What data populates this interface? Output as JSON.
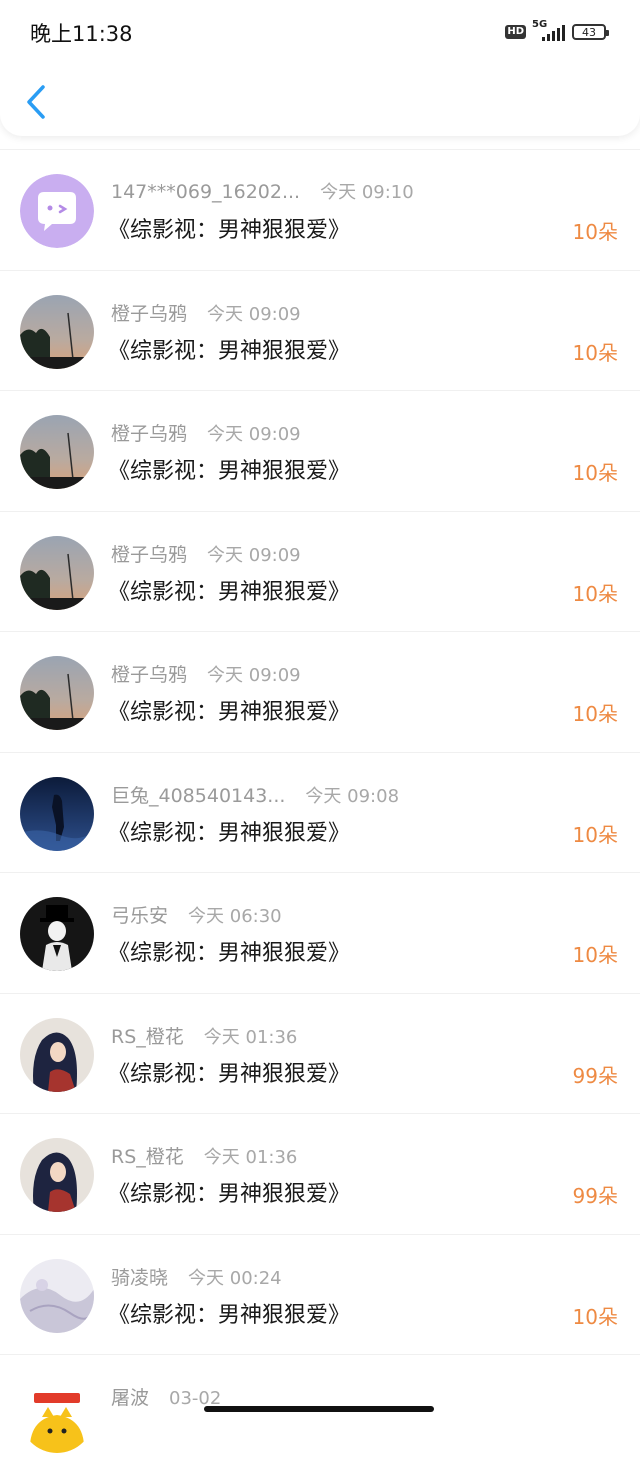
{
  "status_bar": {
    "time": "晚上11:38",
    "hd": "HD",
    "network": "5G",
    "battery": "43"
  },
  "colors": {
    "accent_blue": "#2a9df4",
    "amount_orange": "#ee8a43"
  },
  "rows": [
    {
      "name": "147***069_16202...",
      "time": "今天 09:10",
      "book": "《综影视：男神狠狠爱》",
      "amount": "10朵",
      "avatar": "chat-bubble-avatar"
    },
    {
      "name": "橙子乌鸦",
      "time": "今天 09:09",
      "book": "《综影视：男神狠狠爱》",
      "amount": "10朵",
      "avatar": "sunset-photo-avatar"
    },
    {
      "name": "橙子乌鸦",
      "time": "今天 09:09",
      "book": "《综影视：男神狠狠爱》",
      "amount": "10朵",
      "avatar": "sunset-photo-avatar"
    },
    {
      "name": "橙子乌鸦",
      "time": "今天 09:09",
      "book": "《综影视：男神狠狠爱》",
      "amount": "10朵",
      "avatar": "sunset-photo-avatar"
    },
    {
      "name": "橙子乌鸦",
      "time": "今天 09:09",
      "book": "《综影视：男神狠狠爱》",
      "amount": "10朵",
      "avatar": "sunset-photo-avatar"
    },
    {
      "name": "巨兔_408540143...",
      "time": "今天 09:08",
      "book": "《综影视：男神狠狠爱》",
      "amount": "10朵",
      "avatar": "blue-night-avatar"
    },
    {
      "name": "弓乐安",
      "time": "今天 06:30",
      "book": "《综影视：男神狠狠爱》",
      "amount": "10朵",
      "avatar": "top-hat-avatar"
    },
    {
      "name": "RS_橙花",
      "time": "今天 01:36",
      "book": "《综影视：男神狠狠爱》",
      "amount": "99朵",
      "avatar": "illustrated-girl-avatar"
    },
    {
      "name": "RS_橙花",
      "time": "今天 01:36",
      "book": "《综影视：男神狠狠爱》",
      "amount": "99朵",
      "avatar": "illustrated-girl-avatar"
    },
    {
      "name": "骑凌晓",
      "time": "今天 00:24",
      "book": "《综影视：男神狠狠爱》",
      "amount": "10朵",
      "avatar": "lace-avatar"
    },
    {
      "name": "屠波",
      "time": "03-02",
      "book": "",
      "amount": "",
      "avatar": "cartoon-chick-avatar"
    }
  ]
}
